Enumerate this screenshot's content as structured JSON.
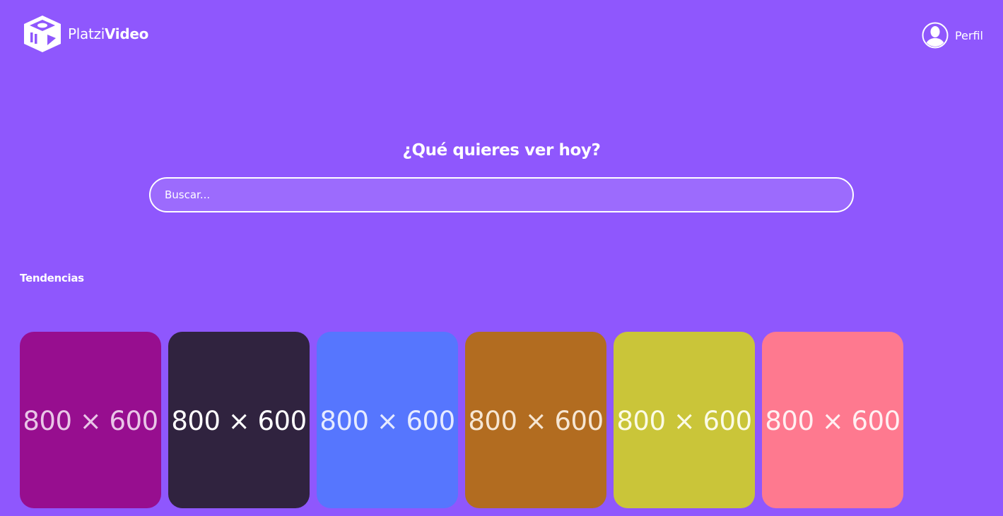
{
  "header": {
    "logo": {
      "light_text": "Platzi",
      "bold_text": "Video"
    },
    "profile": {
      "label": "Perfil",
      "icon": "user-avatar-icon"
    }
  },
  "hero": {
    "title": "¿Qué quieres ver hoy?",
    "search": {
      "placeholder": "Buscar...",
      "value": ""
    }
  },
  "sections": {
    "trending": {
      "title": "Tendencias",
      "items": [
        {
          "label": "800 × 600",
          "color": "#970e8f",
          "text_color": "#e9c6e7"
        },
        {
          "label": "800 × 600",
          "color": "#30233f",
          "text_color": "#ffffff"
        },
        {
          "label": "800 × 600",
          "color": "#5676fe",
          "text_color": "#e6ebff"
        },
        {
          "label": "800 × 600",
          "color": "#b26c20",
          "text_color": "#f6e6d3"
        },
        {
          "label": "800 × 600",
          "color": "#cac539",
          "text_color": "#fbfbe6"
        },
        {
          "label": "800 × 600",
          "color": "#fe798f",
          "text_color": "#fff0f2"
        }
      ]
    }
  },
  "colors": {
    "background": "#8f57fd",
    "text": "#ffffff"
  }
}
